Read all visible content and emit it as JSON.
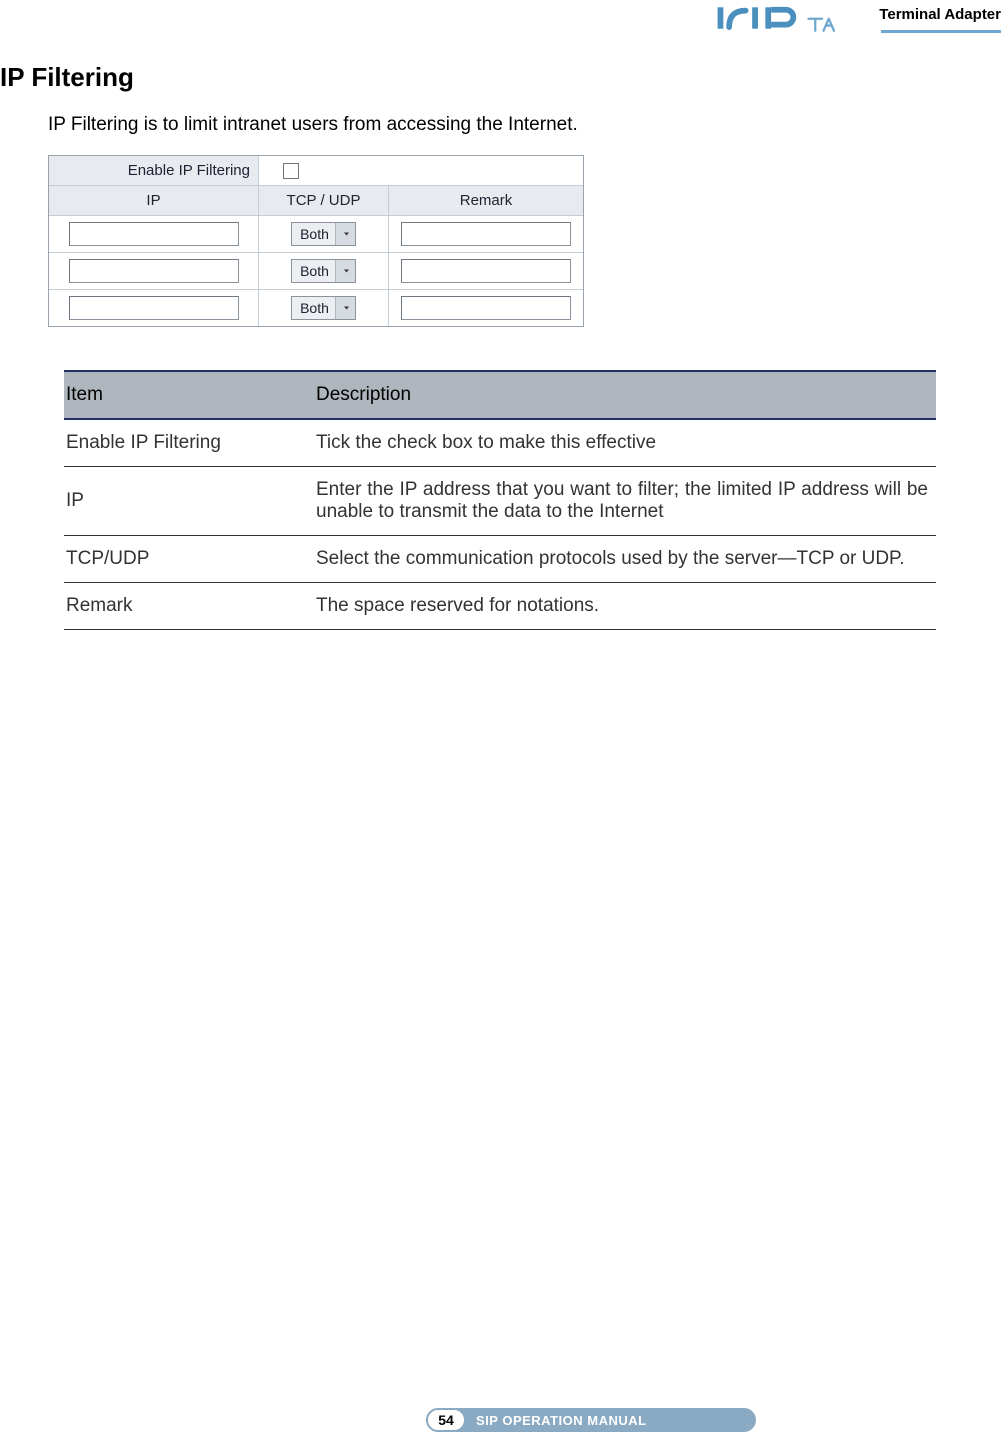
{
  "header": {
    "product_line": "Terminal Adapter",
    "logo_text": "SIP"
  },
  "section": {
    "title": "IP Filtering",
    "intro": "IP Filtering is to limit intranet users from accessing the Internet."
  },
  "ui": {
    "enable_label": "Enable IP Filtering",
    "columns": {
      "ip": "IP",
      "proto": "TCP / UDP",
      "remark": "Remark"
    },
    "select_value": "Both",
    "rows": 3
  },
  "desc": {
    "head_item": "Item",
    "head_desc": "Description",
    "rows": [
      {
        "item": "Enable IP Filtering",
        "desc": "Tick the check box to make this effective"
      },
      {
        "item": "IP",
        "desc": "Enter the IP address that you want to filter; the limited IP address will be unable to transmit the data to the Internet"
      },
      {
        "item": "TCP/UDP",
        "desc": "Select the communication protocols used by the server—TCP or UDP."
      },
      {
        "item": "Remark",
        "desc": "The space reserved for notations."
      }
    ]
  },
  "footer": {
    "page": "54",
    "manual": "SIP OPERATION MANUAL"
  }
}
